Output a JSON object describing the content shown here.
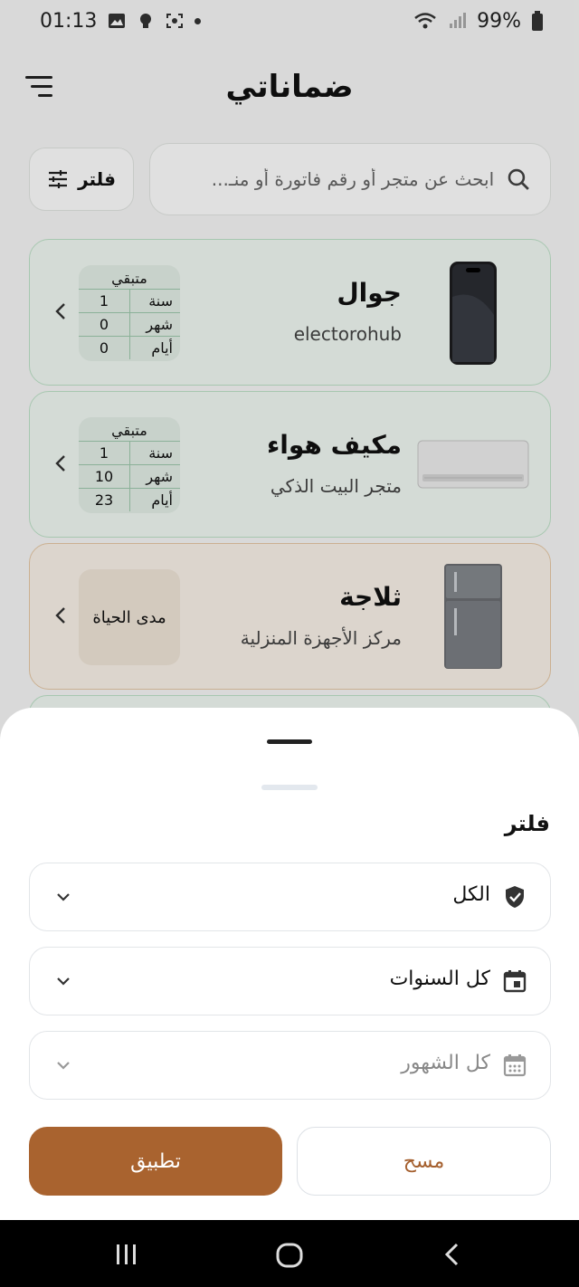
{
  "status_bar": {
    "time": "01:13",
    "battery": "99%"
  },
  "app": {
    "title": "ضماناتي"
  },
  "search": {
    "placeholder": "ابحث عن متجر أو رقم فاتورة أو منـ..."
  },
  "filter_button": {
    "label": "فلتر"
  },
  "remaining_labels": {
    "header": "متبقي",
    "year": "سنة",
    "month": "شهر",
    "days": "أيام"
  },
  "warranties": [
    {
      "name": "جوال",
      "store": "electorohub",
      "image": "smartphone-image",
      "years": "1",
      "months": "0",
      "days": "0",
      "status": "active",
      "status_color": "#bfe3c9"
    },
    {
      "name": "مكيف هواء",
      "store": "متجر البيت الذكي",
      "image": "air-conditioner-image",
      "years": "1",
      "months": "10",
      "days": "23",
      "status": "active",
      "status_color": "#bfe3c9"
    },
    {
      "name": "ثلاجة",
      "store": "مركز الأجهزة المنزلية",
      "image": "refrigerator-image",
      "lifetime_label": "مدى الحياة",
      "status": "lifetime",
      "status_color": "#e7c9a6"
    }
  ],
  "filter_sheet": {
    "title": "فلتر",
    "status_select": {
      "value": "الكل",
      "icon": "verified-shield-icon"
    },
    "year_select": {
      "value": "كل السنوات",
      "icon": "calendar-icon"
    },
    "month_select": {
      "value": "كل الشهور",
      "icon": "calendar-month-icon",
      "disabled": true
    },
    "clear_label": "مسح",
    "apply_label": "تطبيق"
  },
  "colors": {
    "accent": "#a9632f",
    "active_border": "#bfe3c9",
    "lifetime_border": "#e7c9a6"
  }
}
